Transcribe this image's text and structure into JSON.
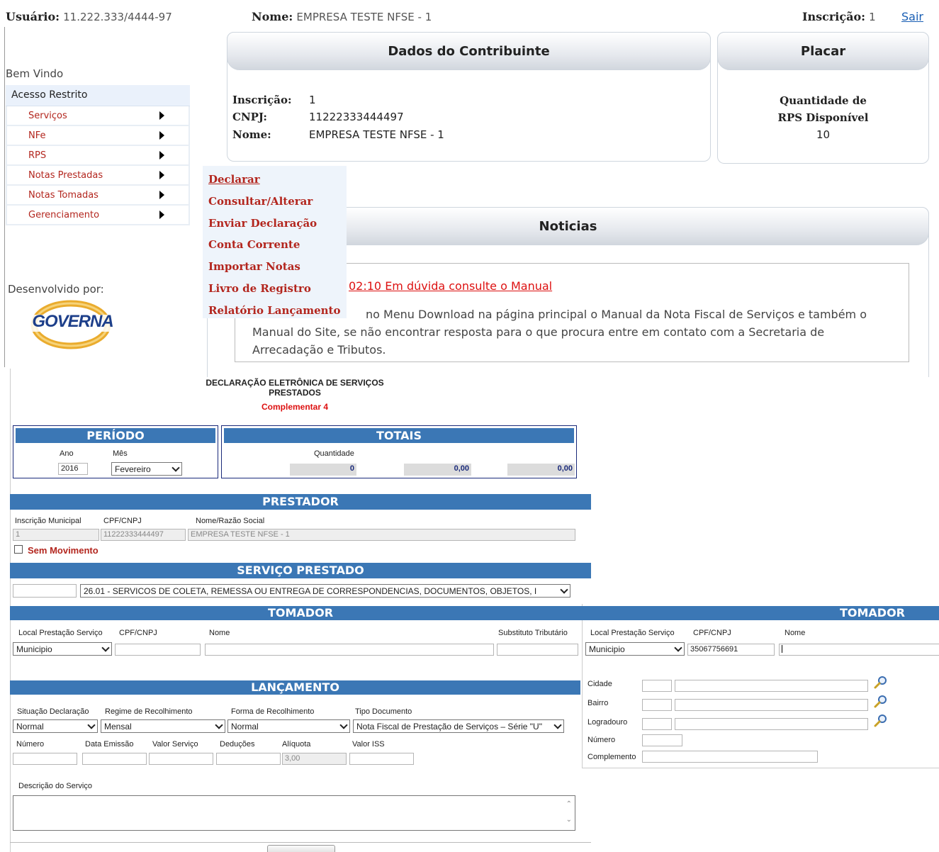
{
  "header": {
    "usuario_label": "Usuário:",
    "usuario_value": "11.222.333/4444-97",
    "nome_label": "Nome:",
    "nome_value": "EMPRESA TESTE NFSE - 1",
    "inscricao_label": "Inscrição:",
    "inscricao_value": "1",
    "sair": "Sair"
  },
  "sidebar": {
    "welcome": "Bem Vindo",
    "restricted": "Acesso Restrito",
    "items": [
      {
        "label": "Serviços"
      },
      {
        "label": "NFe"
      },
      {
        "label": "RPS"
      },
      {
        "label": "Notas Prestadas"
      },
      {
        "label": "Notas Tomadas"
      },
      {
        "label": "Gerenciamento"
      }
    ],
    "developed_by": "Desenvolvido por:",
    "logo_text": "GOVERNA"
  },
  "submenu": {
    "items": [
      {
        "label": "Declarar"
      },
      {
        "label": "Consultar/Alterar"
      },
      {
        "label": "Enviar Declaração"
      },
      {
        "label": "Conta Corrente"
      },
      {
        "label": "Importar Notas"
      },
      {
        "label": "Livro de Registro"
      },
      {
        "label": "Relatório Lançamento"
      }
    ]
  },
  "dados": {
    "title": "Dados do Contribuinte",
    "inscricao_label": "Inscrição:",
    "inscricao_value": "1",
    "cnpj_label": "CNPJ:",
    "cnpj_value": "11222333444497",
    "nome_label": "Nome:",
    "nome_value": "EMPRESA TESTE NFSE - 1"
  },
  "placar": {
    "title": "Placar",
    "line1": "Quantidade de",
    "line2": "RPS Disponível",
    "value": "10"
  },
  "noticias": {
    "title": "Noticias",
    "link": "02:10   Em dúvida consulte o Manual",
    "text_line1": "no Menu Download na página principal o Manual da Nota Fiscal de Serviços e também o",
    "text_line2": "Manual do Site, se não encontrar resposta para o que procura entre em contato com a Secretaria de",
    "text_line3": "Arrecadação e Tributos."
  },
  "form": {
    "title_line1": "DECLARAÇÃO ELETRÔNICA DE SERVIÇOS",
    "title_line2": "PRESTADOS",
    "subtitle": "Complementar 4",
    "periodo": {
      "title": "PERÍODO",
      "ano_label": "Ano",
      "ano_value": "2016",
      "mes_label": "Mês",
      "mes_value": "Fevereiro"
    },
    "totais": {
      "title": "TOTAIS",
      "quantidade_label": "Quantidade",
      "quantidade_value": "0",
      "value2": "0,00",
      "value3": "0,00"
    },
    "prestador": {
      "title": "PRESTADOR",
      "inscricao_label": "Inscrição Municipal",
      "cpf_label": "CPF/CNPJ",
      "nome_label": "Nome/Razão Social",
      "inscricao_value": "1",
      "cpf_value": "11222333444497",
      "nome_value": "EMPRESA TESTE NFSE - 1",
      "sem_movimento": "Sem Movimento"
    },
    "servico": {
      "title": "SERVIÇO PRESTADO",
      "code_value": "",
      "selected": "26.01 - SERVICOS DE COLETA, REMESSA OU ENTREGA DE CORRESPONDENCIAS, DOCUMENTOS, OBJETOS, I"
    },
    "tomador": {
      "title": "TOMADOR",
      "local_label": "Local Prestação Serviço",
      "cpf_label": "CPF/CNPJ",
      "nome_label": "Nome",
      "substituto_label": "Substituto Tributário",
      "local_value": "Municipio"
    },
    "lancamento": {
      "title": "LANÇAMENTO",
      "situacao_label": "Situação Declaração",
      "regime_label": "Regime de Recolhimento",
      "forma_label": "Forma de Recolhimento",
      "tipo_label": "Tipo Documento",
      "situacao_value": "Normal",
      "regime_value": "Mensal",
      "forma_value": "Normal",
      "tipo_value": "Nota Fiscal de Prestação de Serviços – Série \"U\"",
      "numero_label": "Número",
      "data_label": "Data Emissão",
      "valor_label": "Valor Serviço",
      "deducoes_label": "Deduções",
      "aliquota_label": "Alíquota",
      "valor_iss_label": "Valor ISS",
      "aliquota_value": "3,00",
      "descricao_label": "Descrição do Serviço"
    }
  },
  "tomador2": {
    "title": "TOMADOR",
    "local_label": "Local Prestação Serviço",
    "cpf_label": "CPF/CNPJ",
    "nome_label": "Nome",
    "local_value": "Municipio",
    "cpf_value": "35067756691",
    "cidade_label": "Cidade",
    "bairro_label": "Bairro",
    "logradouro_label": "Logradouro",
    "numero_label": "Número",
    "complemento_label": "Complemento"
  },
  "colors": {
    "accent_blue": "#3b77b5",
    "menu_red": "#b3261e",
    "link_red": "#dd1111"
  }
}
